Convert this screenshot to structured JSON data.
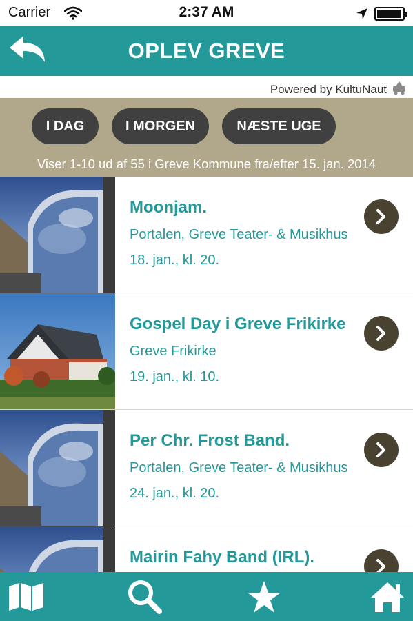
{
  "status_bar": {
    "carrier": "Carrier",
    "time": "2:37 AM"
  },
  "header": {
    "title": "OPLEV GREVE",
    "back_icon": "back-arrow-icon"
  },
  "powered_by": {
    "text": "Powered by KultuNaut"
  },
  "filters": {
    "buttons": [
      {
        "label": "I DAG"
      },
      {
        "label": "I MORGEN"
      },
      {
        "label": "NÆSTE UGE"
      }
    ],
    "info": "Viser 1-10 ud af 55 i Greve Kommune fra/efter 15. jan. 2014"
  },
  "events": [
    {
      "title": "Moonjam.",
      "venue": "Portalen, Greve Teater- & Musikhus",
      "date": "18. jan., kl. 20.",
      "image": "portalen-building"
    },
    {
      "title": "Gospel Day i Greve Frikirke",
      "venue": "Greve Frikirke",
      "date": "19. jan., kl. 10.",
      "image": "greve-frikirke-church"
    },
    {
      "title": "Per Chr. Frost Band.",
      "venue": "Portalen, Greve Teater- & Musikhus",
      "date": "24. jan., kl. 20.",
      "image": "portalen-building"
    },
    {
      "title": "Mairin Fahy Band (IRL).",
      "venue": "",
      "date": "",
      "image": "portalen-building"
    }
  ],
  "tab_bar": {
    "tabs": [
      {
        "icon": "map-icon"
      },
      {
        "icon": "search-icon"
      },
      {
        "icon": "star-icon"
      },
      {
        "icon": "home-icon"
      }
    ]
  },
  "colors": {
    "primary_teal": "#24999a",
    "filter_bg": "#b1a78a",
    "pill_bg": "#404040",
    "chevron_bg": "#4a4231"
  }
}
